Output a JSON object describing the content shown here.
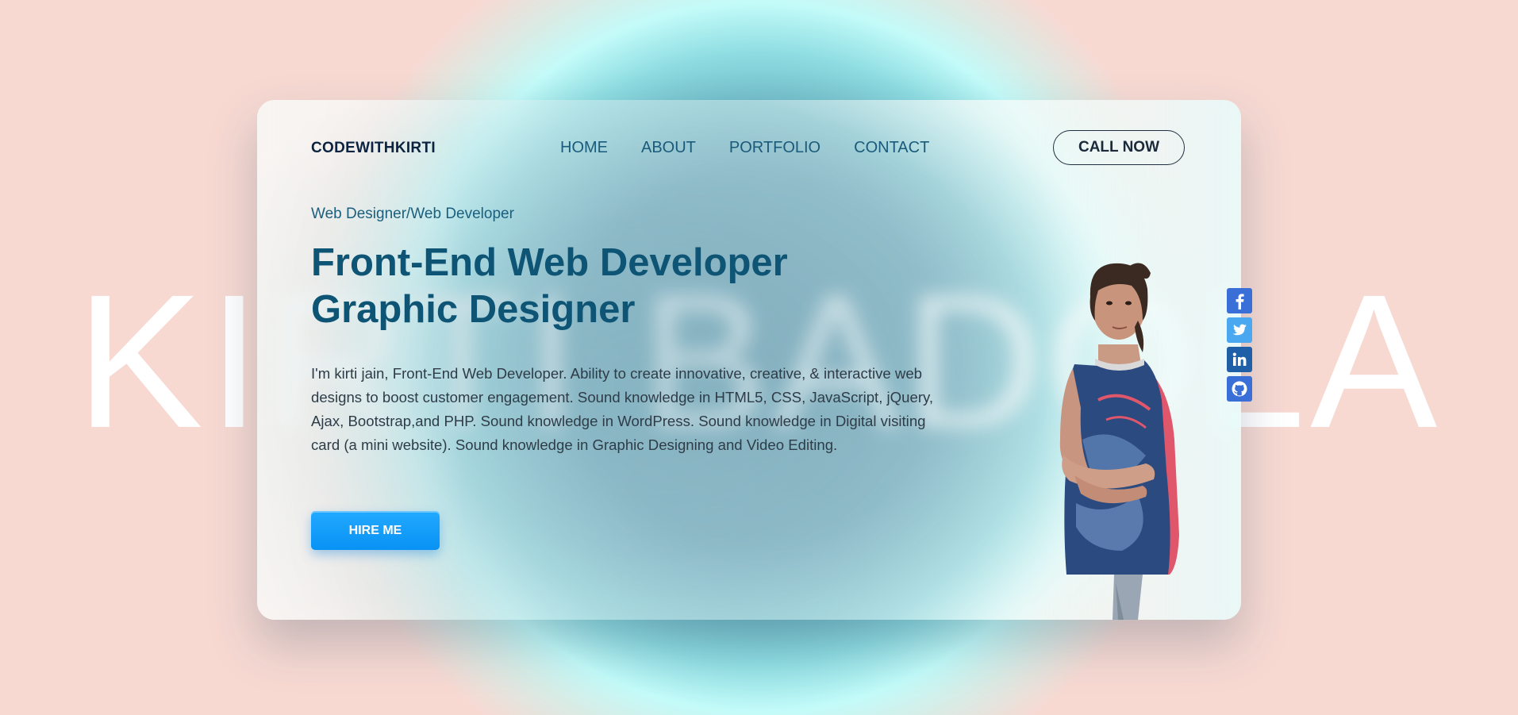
{
  "background": {
    "big_name": "KIRTI BADOLA"
  },
  "header": {
    "logo": "CODEWITHKIRTI",
    "nav": [
      "HOME",
      "ABOUT",
      "PORTFOLIO",
      "CONTACT"
    ],
    "cta": "CALL NOW"
  },
  "hero": {
    "subtitle": "Web Designer/Web Developer",
    "headline_line1": "Front-End Web Developer",
    "headline_line2": "Graphic Designer",
    "description": "I'm kirti jain, Front-End Web Developer. Ability to create innovative, creative, & interactive web designs to boost customer engagement. Sound knowledge in HTML5, CSS, JavaScript, jQuery, Ajax, Bootstrap,and PHP. Sound knowledge in WordPress. Sound knowledge in Digital visiting card (a mini website). Sound knowledge in Graphic Designing and Video Editing.",
    "button": "HIRE ME"
  },
  "socials": [
    {
      "icon": "facebook-icon",
      "color": "#3b6fd8"
    },
    {
      "icon": "twitter-icon",
      "color": "#4aa8f0"
    },
    {
      "icon": "linkedin-icon",
      "color": "#1f5fa8"
    },
    {
      "icon": "github-icon",
      "color": "#3b6fd8"
    }
  ],
  "colors": {
    "accent": "#0892f4",
    "heading": "#0e5474",
    "nav": "#1a5a7a",
    "page_bg": "#f7d9d2"
  }
}
